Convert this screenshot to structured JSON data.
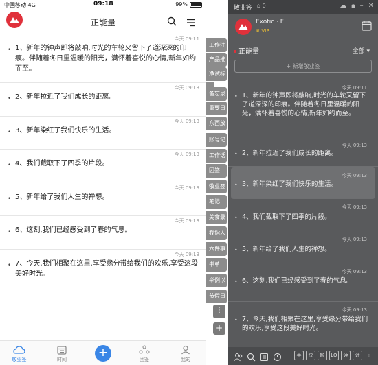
{
  "phone": {
    "status": {
      "carrier": "中国移动",
      "network": "4G",
      "clock": "09:18",
      "battery": "99%"
    },
    "nav": {
      "title": "正能量"
    },
    "notes": [
      {
        "time": "今天 09:11",
        "text": "1、新年的钟声即将敲响,时光的车轮又留下了道深深的印痕。伴随着冬日里温暖的阳光，满怀着喜悦的心情,新年如约而至。"
      },
      {
        "time": "今天 09:13",
        "text": "2、新年拉近了我们成长的距离。"
      },
      {
        "time": "今天 09:13",
        "text": "3、新年染红了我们快乐的生活。"
      },
      {
        "time": "今天 09:13",
        "text": "4、我们截取下了四季的片段。"
      },
      {
        "time": "今天 09:13",
        "text": "5、新年给了我们人生的禅想。"
      },
      {
        "time": "今天 09:13",
        "text": "6、这刻,我们已经感受到了春的气息。"
      },
      {
        "time": "今天 09:13",
        "text": "7、今天,我们相聚在这里,享受缘分带给我们的欢乐,享受这段美好时光。"
      }
    ],
    "tabs": [
      {
        "label": "敬业签"
      },
      {
        "label": "时间"
      },
      {
        "label": "团签"
      },
      {
        "label": "我的"
      }
    ],
    "fab_label": "+"
  },
  "categories": [
    "工作注",
    "产品推",
    "净试标",
    "普通",
    "备忘录",
    "重要日",
    "东西放",
    "账号记",
    "工作话",
    "团签",
    "敬业签",
    "笔记",
    "美食录",
    "我指人",
    "六件事",
    "书单",
    "举例以",
    "节假日"
  ],
  "category_more": "⋮",
  "category_add": "+",
  "widget": {
    "app_name": "敬业签",
    "count": "0",
    "user": "Exotic · F",
    "vip": "VIP",
    "category": "正能量",
    "filter": "全部",
    "add_label": "+ 新增敬业签",
    "notes": [
      {
        "time": "今天 09:11",
        "text": "1、新年的钟声即将敲响,时光的车轮又留下了道深深的印痕。伴随着冬日里温暖的阳光，满怀着喜悦的心情,新年如约而至。"
      },
      {
        "time": "今天 09:13",
        "text": "2、新年拉近了我们成长的距离。"
      },
      {
        "time": "今天 09:13",
        "text": "3、新年染红了我们快乐的生活。"
      },
      {
        "time": "今天 09:13",
        "text": "4、我们截取下了四季的片段。"
      },
      {
        "time": "今天 09:13",
        "text": "5、新年给了我们人生的禅想。"
      },
      {
        "time": "今天 09:13",
        "text": "6、这刻,我们已经感受到了春的气息。"
      },
      {
        "time": "今天 09:13",
        "text": "7、今天,我们相聚在这里,享受缘分带给我们的欢乐,享受这段美好时光。"
      }
    ],
    "toolbar_keys": [
      "手",
      "快",
      "颜",
      "LO",
      "读",
      "计",
      "⋮"
    ]
  },
  "colors": {
    "brand_red": "#e0313b",
    "accent_blue": "#3a86e6",
    "widget_bg": "#595a5c",
    "vip_gold": "#f1c232"
  }
}
